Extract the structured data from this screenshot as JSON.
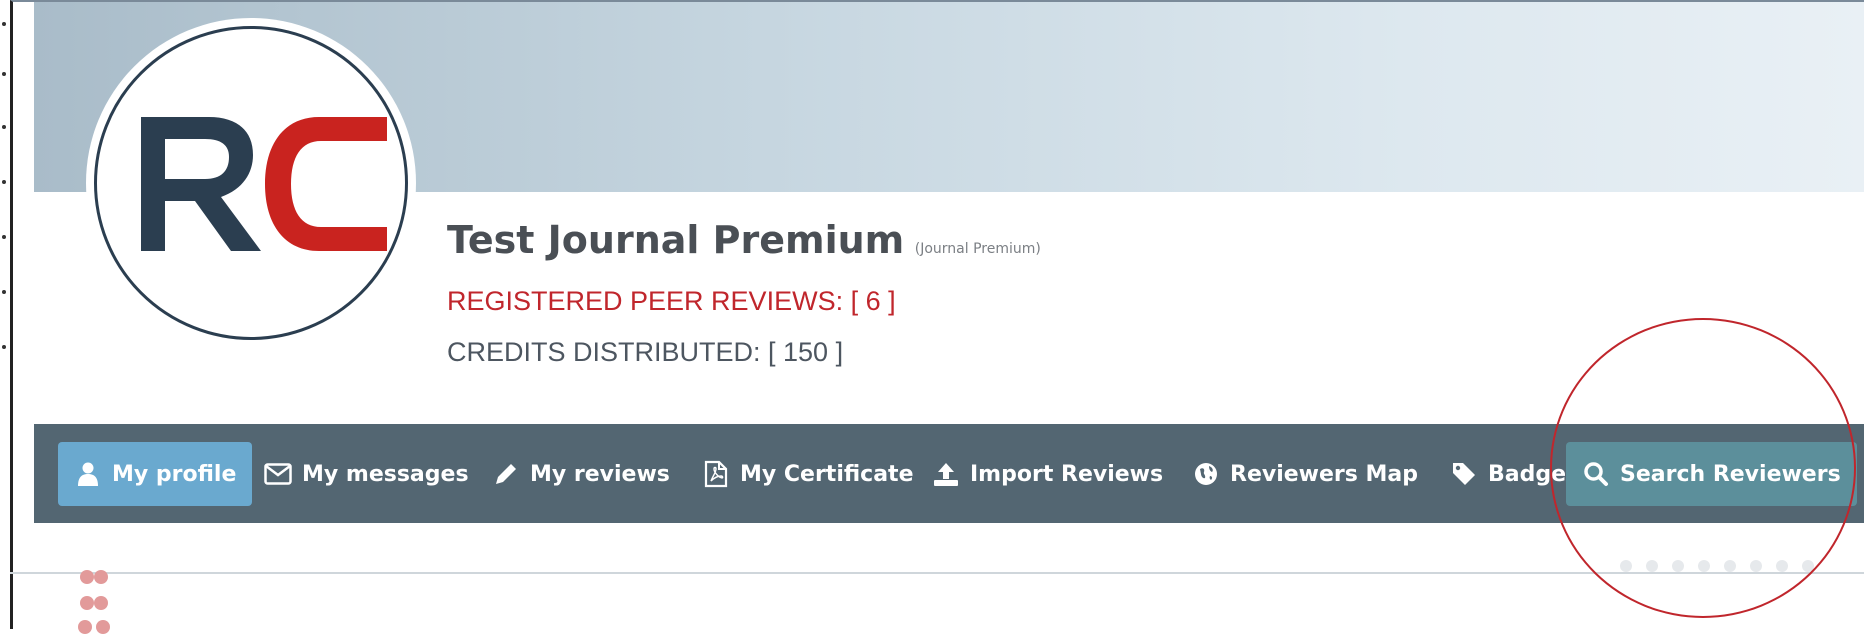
{
  "profile": {
    "logo_text": "RC",
    "name": "Test Journal Premium",
    "account_type": "(Journal Premium)",
    "registered_reviews_label": "REGISTERED PEER REVIEWS: [ 6 ]",
    "credits_label": "CREDITS DISTRIBUTED: [ 150 ]"
  },
  "nav": {
    "items": [
      {
        "label": "My profile",
        "icon": "user-icon",
        "state": "active"
      },
      {
        "label": "My messages",
        "icon": "envelope-icon"
      },
      {
        "label": "My reviews",
        "icon": "pencil-icon"
      },
      {
        "label": "My Certificate",
        "icon": "pdf-file-icon"
      },
      {
        "label": "Import Reviews",
        "icon": "upload-icon"
      },
      {
        "label": "Reviewers Map",
        "icon": "globe-icon"
      },
      {
        "label": "Badge",
        "icon": "tag-icon"
      },
      {
        "label": "Search Reviewers",
        "icon": "search-icon",
        "state": "highlighted"
      }
    ]
  },
  "colors": {
    "brand_navy": "#2b3e50",
    "brand_red": "#c9231f",
    "navbar": "#536672",
    "active_tab": "#6aa9cf",
    "annotation": "#c0262c"
  }
}
